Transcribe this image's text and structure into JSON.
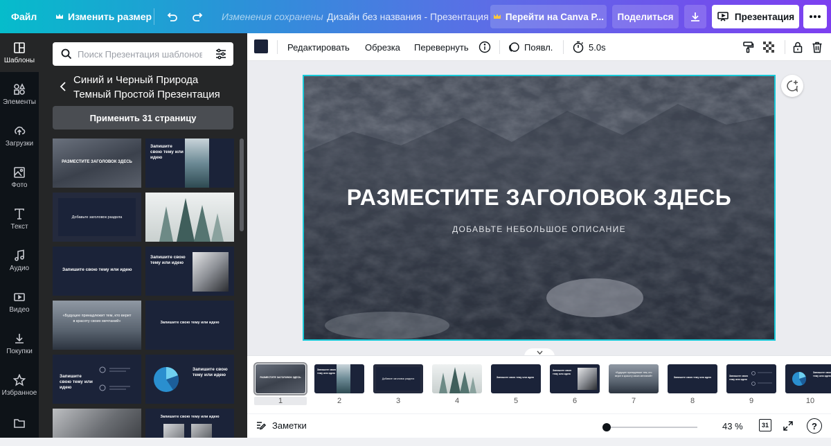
{
  "topbar": {
    "file": "Файл",
    "resize": "Изменить размер",
    "saved": "Изменения сохранены",
    "title": "Дизайн без названия - Презентация",
    "upgrade": "Перейти на Canva P...",
    "share": "Поделиться",
    "present": "Презентация",
    "crown_icon": "crown-icon"
  },
  "rail": {
    "items": [
      {
        "label": "Шаблоны",
        "icon": "templates-icon"
      },
      {
        "label": "Элементы",
        "icon": "elements-icon"
      },
      {
        "label": "Загрузки",
        "icon": "upload-icon"
      },
      {
        "label": "Фото",
        "icon": "photo-icon"
      },
      {
        "label": "Текст",
        "icon": "text-icon"
      },
      {
        "label": "Аудио",
        "icon": "audio-icon"
      },
      {
        "label": "Видео",
        "icon": "video-icon"
      },
      {
        "label": "Покупки",
        "icon": "download-icon"
      },
      {
        "label": "Избранное",
        "icon": "star-icon"
      },
      {
        "label": "",
        "icon": "folder-icon"
      }
    ]
  },
  "panel": {
    "search_placeholder": "Поиск Презентация шаблонов",
    "template_name": "Синий и Черный Природа Темный Простой Презентация",
    "apply": "Применить 31 страницу",
    "thumbs": {
      "t1": "РАЗМЕСТИТЕ ЗАГОЛОВОК ЗДЕСЬ",
      "t2": "Запишите свою тему или идею",
      "t3": "Добавьте заголовок раздела",
      "t5": "Запишите свою тему или идею",
      "t6": "Запишите свою тему или идею",
      "t7": "«Будущее принадлежит тем, кто верит в красоту своих мечтаний»",
      "t8": "Запишите свою тему или идею",
      "t9": "Запишите свою тему или идею",
      "t10": "Запишите свою тему или идею",
      "t12": "Запишите свою тему или идею"
    }
  },
  "toolbar": {
    "edit": "Редактировать",
    "crop": "Обрезка",
    "flip": "Перевернуть",
    "animate": "Появл.",
    "duration": "5.0s",
    "color": "#1b2339"
  },
  "slide": {
    "title": "РАЗМЕСТИТЕ ЗАГОЛОВОК ЗДЕСЬ",
    "subtitle": "ДОБАВЬТЕ НЕБОЛЬШОЕ ОПИСАНИЕ"
  },
  "pages": [
    "1",
    "2",
    "3",
    "4",
    "5",
    "6",
    "7",
    "8",
    "9",
    "10"
  ],
  "bottom": {
    "notes": "Заметки",
    "zoom": "43 %",
    "zoom_fraction": 0.1,
    "page_count": "31",
    "help": "?"
  },
  "colors": {
    "accent": "#19c9d8",
    "dark_panel": "#252627",
    "rail": "#0e1318",
    "slide_navy": "#1b2339"
  }
}
